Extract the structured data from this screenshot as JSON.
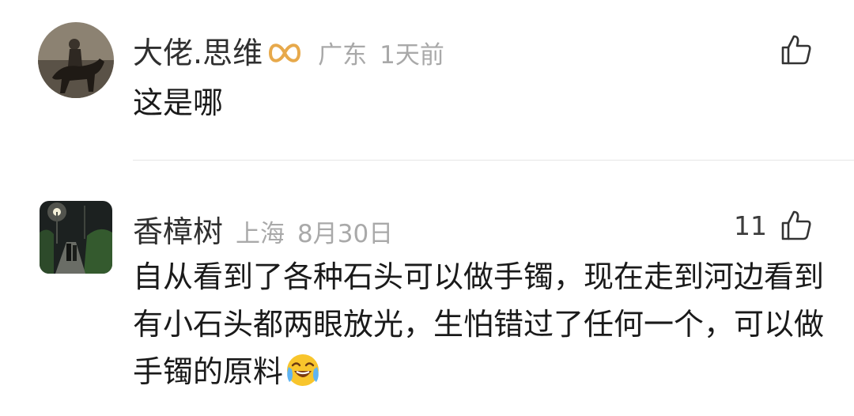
{
  "comments": [
    {
      "username": "大佬.思维",
      "badge_icon": "vip-infinity-badge-icon",
      "badge_color": "#e7a94b",
      "location": "广东",
      "time": "1天前",
      "text": "这是哪",
      "likes": "",
      "like_icon": "thumbs-up-icon"
    },
    {
      "username": "香樟树",
      "location": "上海",
      "time": "8月30日",
      "text": "自从看到了各种石头可以做手镯，现在走到河边看到有小石头都两眼放光，生怕错过了任何一个，可以做手镯的原料",
      "emoji": "crying-laughing-emoji",
      "likes": "11",
      "like_icon": "thumbs-up-icon"
    }
  ]
}
